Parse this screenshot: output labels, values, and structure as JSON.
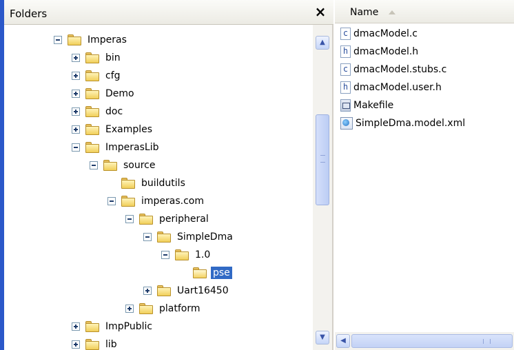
{
  "folders_pane": {
    "title": "Folders",
    "close_glyph": "×"
  },
  "tree": [
    {
      "label": "Imperas",
      "expander": "minus",
      "depth": 0,
      "selected": false
    },
    {
      "label": "bin",
      "expander": "plus",
      "depth": 1,
      "selected": false
    },
    {
      "label": "cfg",
      "expander": "plus",
      "depth": 1,
      "selected": false
    },
    {
      "label": "Demo",
      "expander": "plus",
      "depth": 1,
      "selected": false
    },
    {
      "label": "doc",
      "expander": "plus",
      "depth": 1,
      "selected": false
    },
    {
      "label": "Examples",
      "expander": "plus",
      "depth": 1,
      "selected": false
    },
    {
      "label": "ImperasLib",
      "expander": "minus",
      "depth": 1,
      "selected": false
    },
    {
      "label": "source",
      "expander": "minus",
      "depth": 2,
      "selected": false
    },
    {
      "label": "buildutils",
      "expander": "none",
      "depth": 3,
      "selected": false
    },
    {
      "label": "imperas.com",
      "expander": "minus",
      "depth": 3,
      "selected": false
    },
    {
      "label": "peripheral",
      "expander": "minus",
      "depth": 4,
      "selected": false
    },
    {
      "label": "SimpleDma",
      "expander": "minus",
      "depth": 5,
      "selected": false
    },
    {
      "label": "1.0",
      "expander": "minus",
      "depth": 6,
      "selected": false
    },
    {
      "label": "pse",
      "expander": "none",
      "depth": 7,
      "selected": true
    },
    {
      "label": "Uart16450",
      "expander": "plus",
      "depth": 5,
      "selected": false
    },
    {
      "label": "platform",
      "expander": "plus",
      "depth": 4,
      "selected": false
    },
    {
      "label": "ImpPublic",
      "expander": "plus",
      "depth": 1,
      "selected": false
    },
    {
      "label": "lib",
      "expander": "plus",
      "depth": 1,
      "selected": false
    }
  ],
  "files_pane": {
    "column_name": "Name",
    "sort_icon": "sort-ascending-icon",
    "files": [
      {
        "name": "dmacModel.c",
        "icon": "c-source-file-icon",
        "glyph": "c"
      },
      {
        "name": "dmacModel.h",
        "icon": "header-file-icon",
        "glyph": "h"
      },
      {
        "name": "dmacModel.stubs.c",
        "icon": "c-source-file-icon",
        "glyph": "c"
      },
      {
        "name": "dmacModel.user.h",
        "icon": "header-file-icon",
        "glyph": "h"
      },
      {
        "name": "Makefile",
        "icon": "makefile-icon",
        "glyph": ""
      },
      {
        "name": "SimpleDma.model.xml",
        "icon": "xml-file-icon",
        "glyph": ""
      }
    ]
  },
  "colors": {
    "selection": "#316ac5",
    "left_edge": "#2b58c9",
    "folder": "#f1cf5a"
  }
}
